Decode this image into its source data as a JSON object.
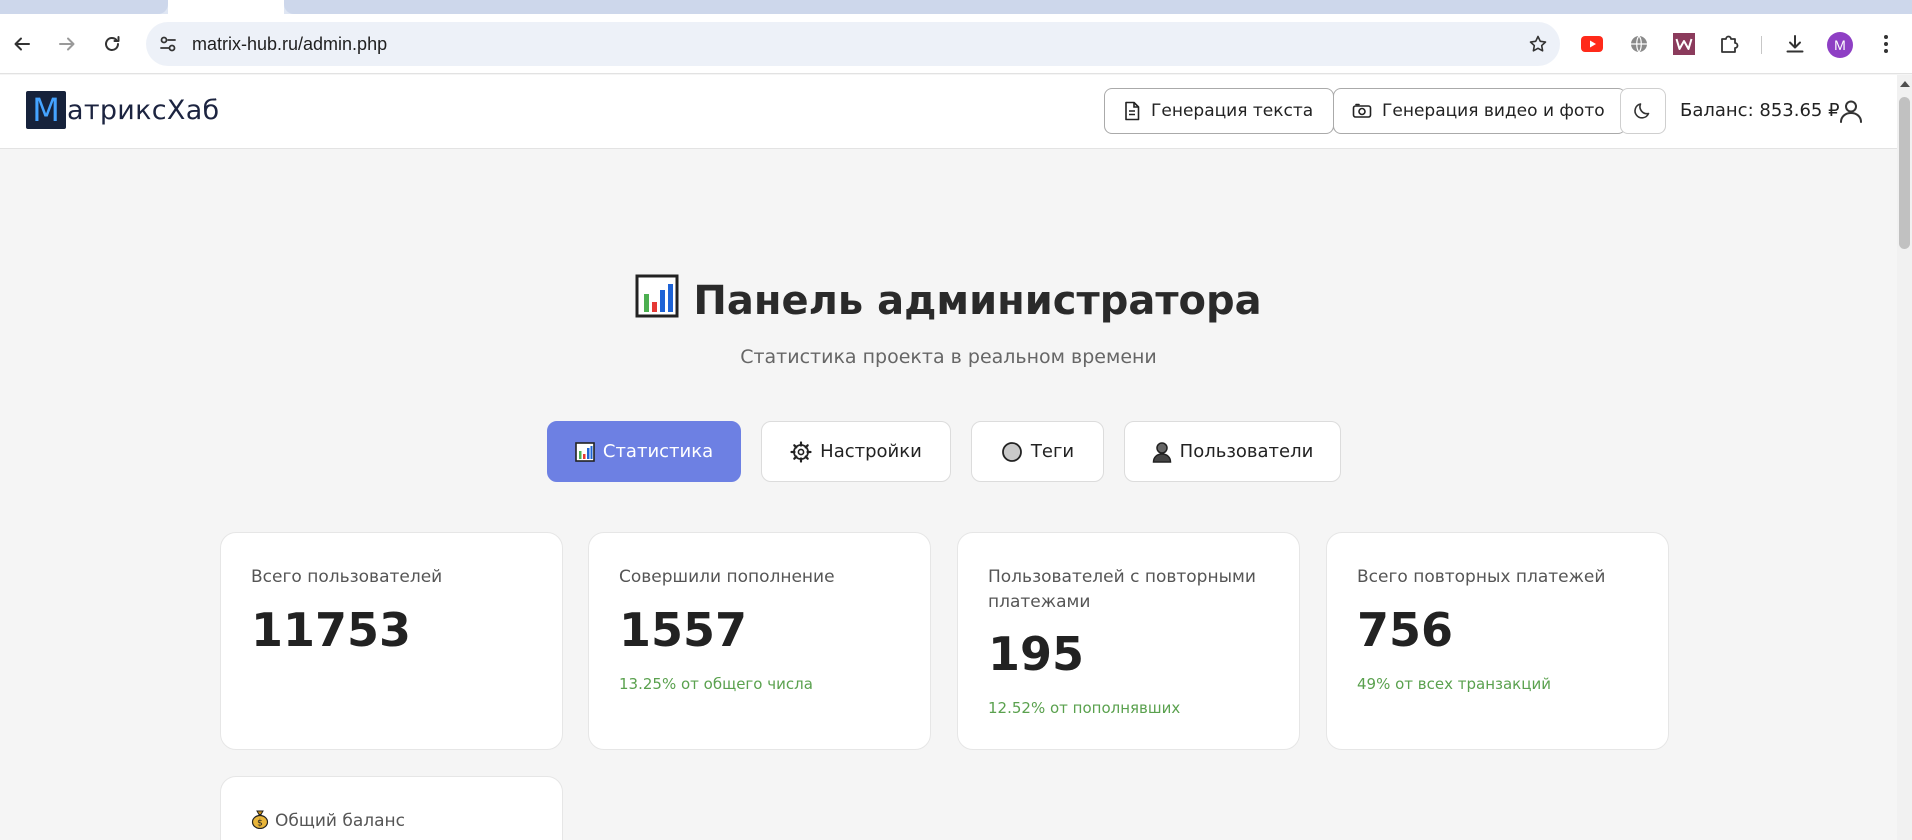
{
  "browser": {
    "url": "matrix-hub.ru/admin.php",
    "profile_initial": "M",
    "extensions": [
      "youtube-icon",
      "globe-icon",
      "w-extension-icon",
      "puzzle-icon"
    ]
  },
  "header": {
    "logo_letter": "М",
    "logo_rest": "атриксХаб",
    "text_gen_label": "Генерация текста",
    "media_gen_label": "Генерация видео и фото",
    "balance": "Баланс: 853.65 ₽"
  },
  "main": {
    "title": "Панель администратора",
    "subtitle": "Статистика проекта в реальном времени",
    "tabs": [
      {
        "label": "Статистика",
        "icon": "bar-chart-icon",
        "active": true
      },
      {
        "label": "Настройки",
        "icon": "gear-icon",
        "active": false
      },
      {
        "label": "Теги",
        "icon": "circle-icon",
        "active": false
      },
      {
        "label": "Пользователи",
        "icon": "person-icon",
        "active": false
      }
    ],
    "stats": [
      {
        "label": "Всего пользователей",
        "value": "11753",
        "note": ""
      },
      {
        "label": "Совершили пополнение",
        "value": "1557",
        "note": "13.25% от общего числа"
      },
      {
        "label": "Пользователей с повторными платежами",
        "value": "195",
        "note": "12.52% от пополнявших"
      },
      {
        "label": "Всего повторных платежей",
        "value": "756",
        "note": "49% от всех транзакций"
      }
    ],
    "balance_card_label": "Общий баланс пользователей"
  },
  "colors": {
    "accent": "#6d80e3",
    "positive_note": "#5aa14e"
  }
}
